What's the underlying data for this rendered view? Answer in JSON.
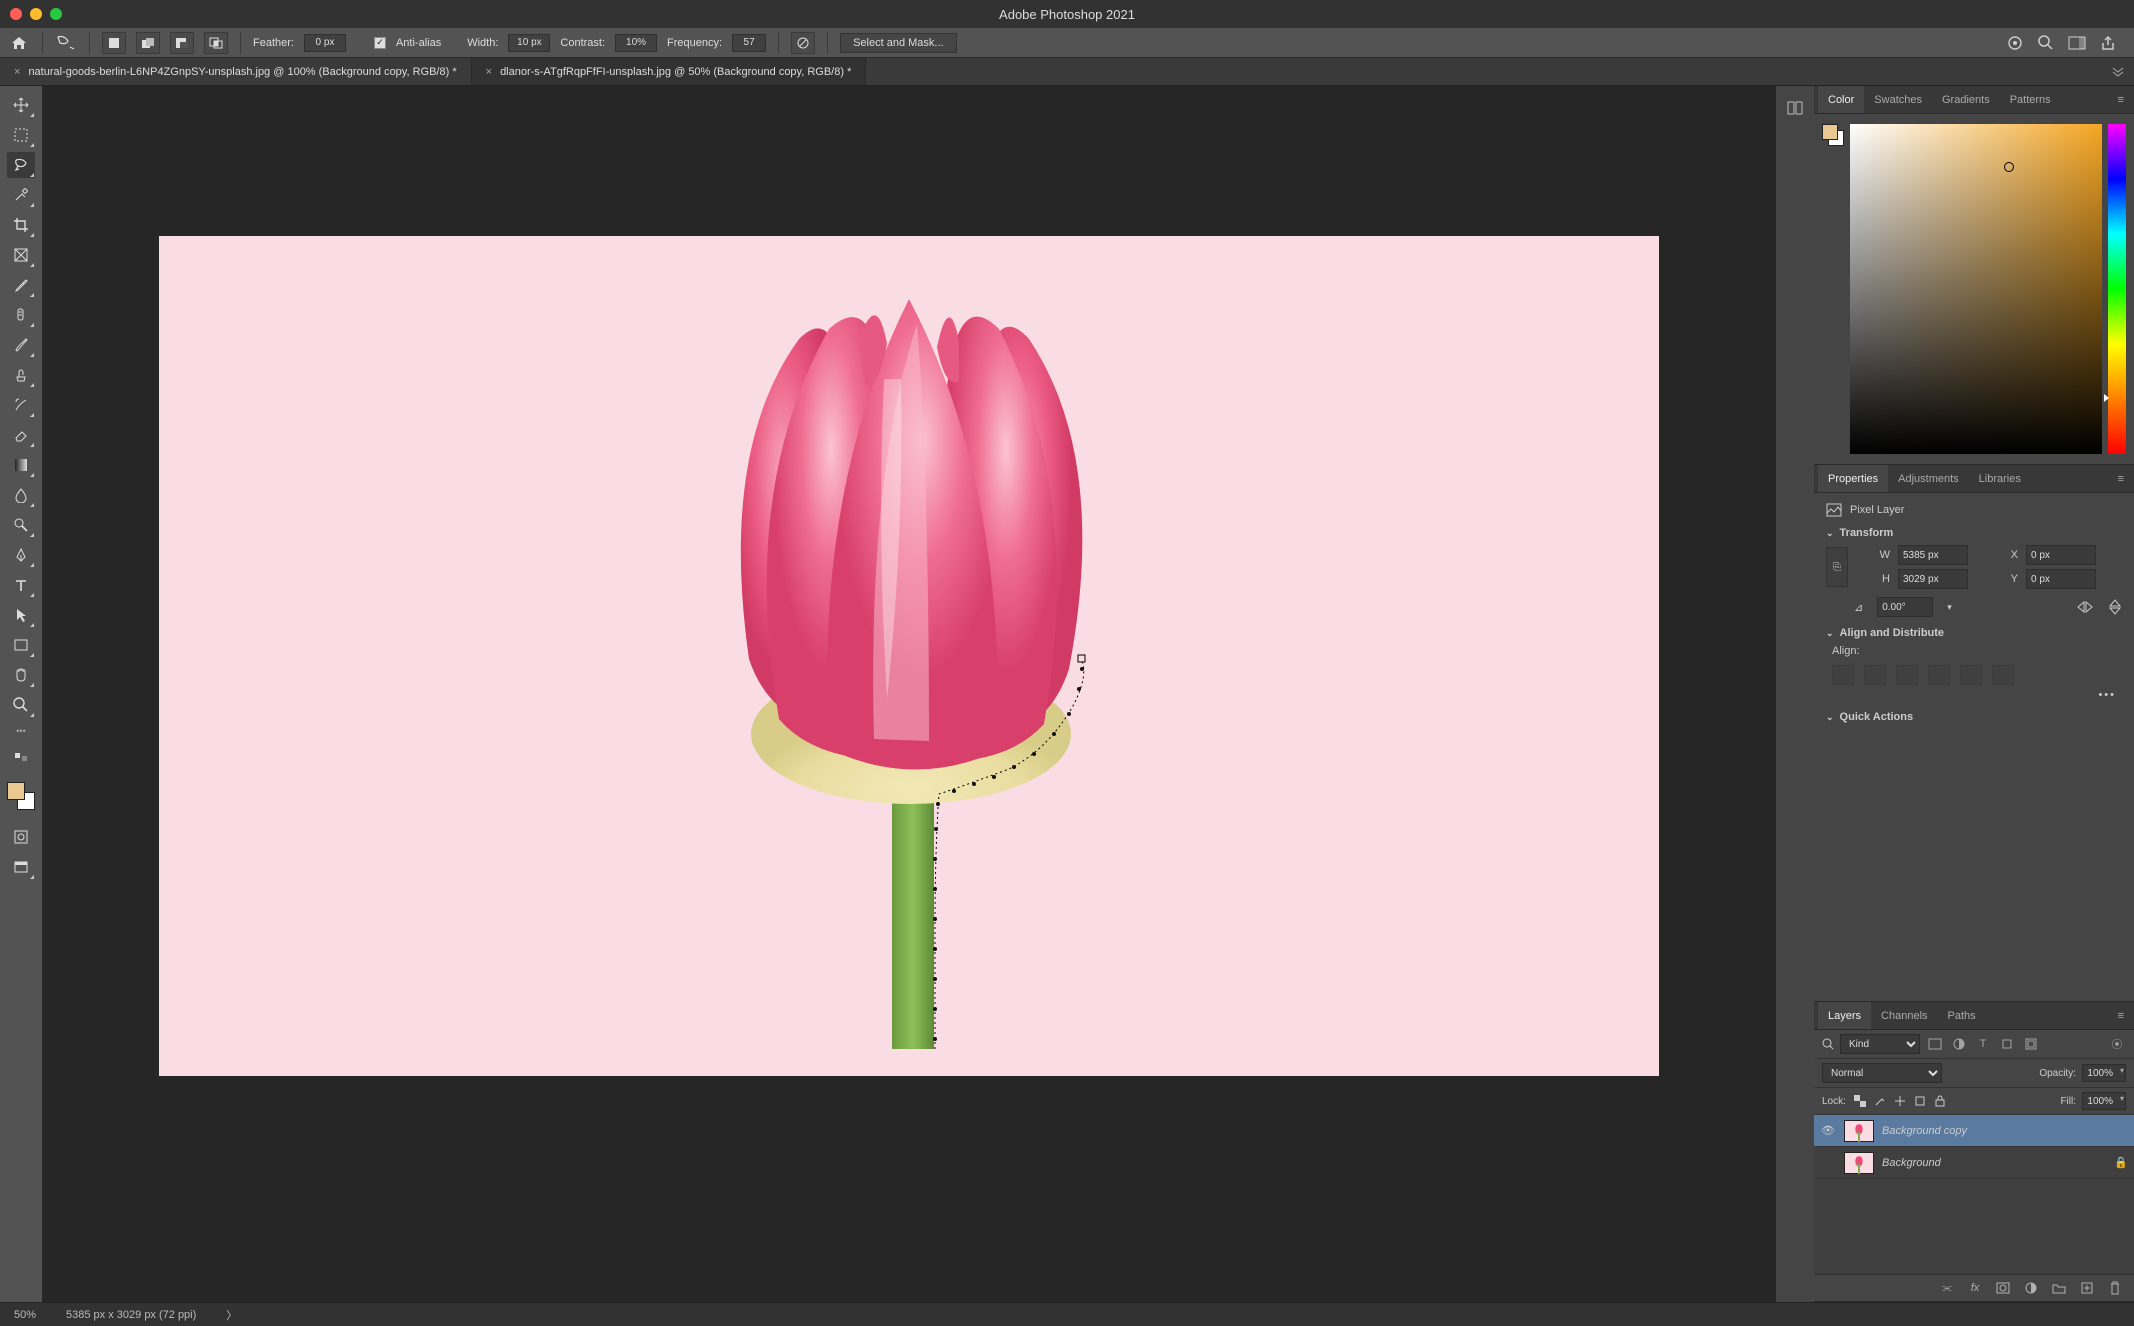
{
  "app_title": "Adobe Photoshop 2021",
  "options_bar": {
    "feather_label": "Feather:",
    "feather_value": "0 px",
    "anti_alias_label": "Anti-alias",
    "width_label": "Width:",
    "width_value": "10 px",
    "contrast_label": "Contrast:",
    "contrast_value": "10%",
    "frequency_label": "Frequency:",
    "frequency_value": "57",
    "select_mask": "Select and Mask..."
  },
  "tabs": [
    {
      "close": "×",
      "label": "natural-goods-berlin-L6NP4ZGnpSY-unsplash.jpg @ 100% (Background copy, RGB/8) *"
    },
    {
      "close": "×",
      "label": "dlanor-s-ATgfRqpFfFI-unsplash.jpg @ 50% (Background copy, RGB/8) *"
    }
  ],
  "color_panel": {
    "tabs": [
      "Color",
      "Swatches",
      "Gradients",
      "Patterns"
    ]
  },
  "properties_panel": {
    "tabs": [
      "Properties",
      "Adjustments",
      "Libraries"
    ],
    "layer_type": "Pixel Layer",
    "transform_head": "Transform",
    "w_label": "W",
    "w_value": "5385 px",
    "h_label": "H",
    "h_value": "3029 px",
    "x_label": "X",
    "x_value": "0 px",
    "y_label": "Y",
    "y_value": "0 px",
    "angle_value": "0.00°",
    "align_head": "Align and Distribute",
    "align_label": "Align:",
    "quick_head": "Quick Actions"
  },
  "layers_panel": {
    "tabs": [
      "Layers",
      "Channels",
      "Paths"
    ],
    "kind_label": "Kind",
    "blend_mode": "Normal",
    "opacity_label": "Opacity:",
    "opacity_value": "100%",
    "lock_label": "Lock:",
    "fill_label": "Fill:",
    "fill_value": "100%",
    "layers": [
      {
        "name": "Background copy",
        "selected": true,
        "visible": true,
        "locked": false
      },
      {
        "name": "Background",
        "selected": false,
        "visible": false,
        "locked": true
      }
    ]
  },
  "status": {
    "zoom": "50%",
    "doc_info": "5385 px x 3029 px (72 ppi)"
  }
}
